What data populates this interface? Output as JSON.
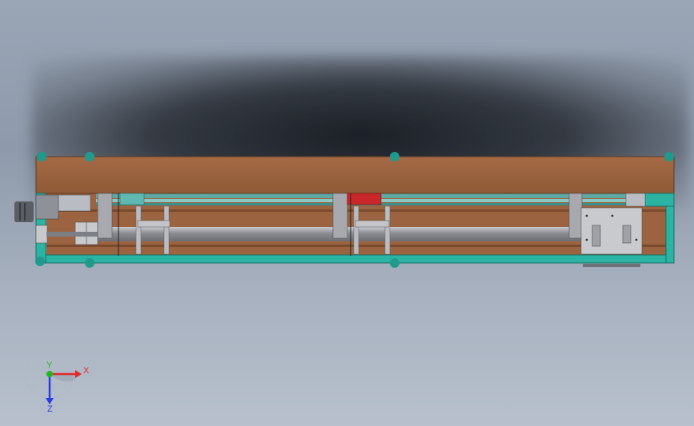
{
  "viewport": {
    "background_top": "#9aa6b6",
    "background_bottom": "#b7c0cc"
  },
  "colors": {
    "wood": "#9b6340",
    "wood_dark": "#7a4a2c",
    "frame_teal": "#2bb3a3",
    "frame_teal_dark": "#1d8e82",
    "roller_gray": "#8e8f95",
    "metal": "#b9bcc2",
    "motor": "#5a5d63",
    "red_part": "#c8282a"
  },
  "triad": {
    "x_label": "X",
    "y_label": "Y",
    "z_label": "Z",
    "x_color": "#e02a2a",
    "y_color": "#22b422",
    "z_color": "#2a3ee0"
  }
}
